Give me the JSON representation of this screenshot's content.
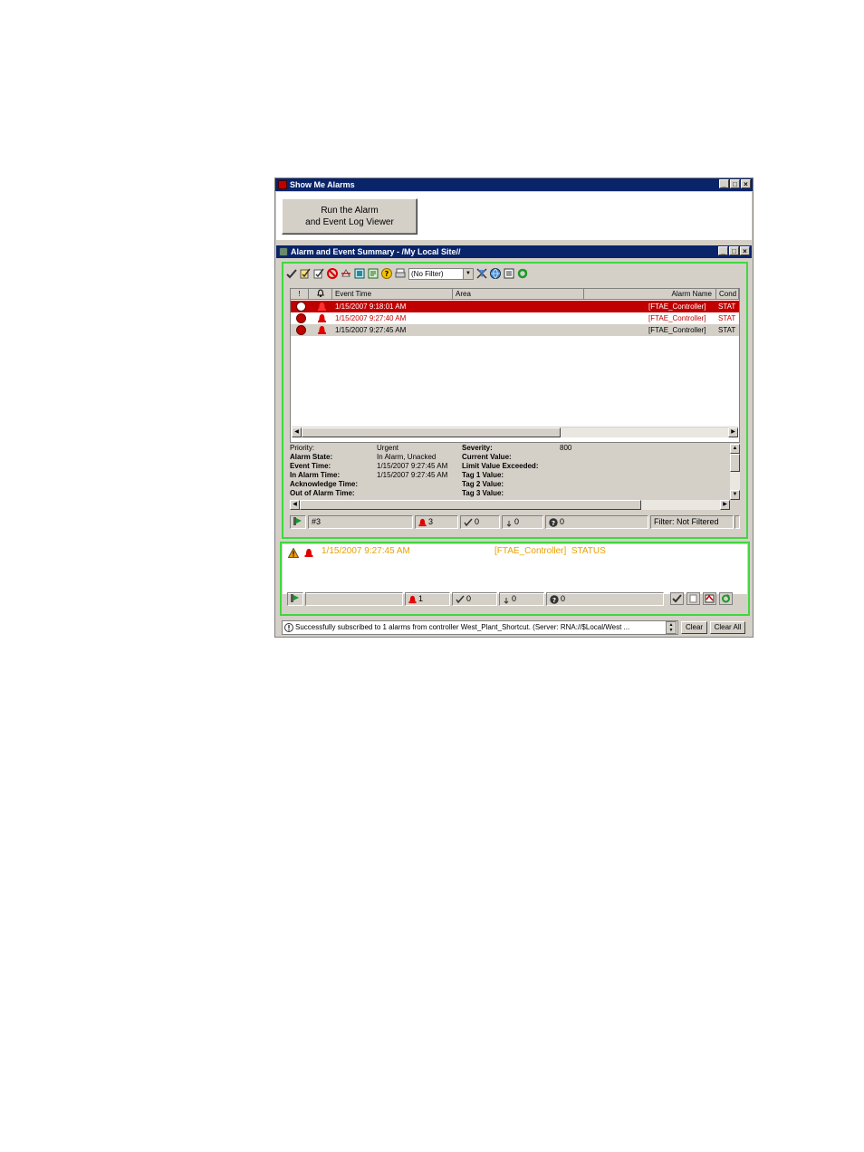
{
  "outer_window": {
    "title": "Show Me Alarms",
    "run_button_label": "Run the Alarm\nand Event Log Viewer"
  },
  "summary_window": {
    "title": "Alarm and Event Summary - /My Local Site//",
    "toolbar": {
      "icons": [
        "acknowledge-icon",
        "acknowledge-page-icon",
        "acknowledge-all-icon",
        "disable-icon",
        "suppress-icon",
        "show-details-icon",
        "properties-icon",
        "help-icon",
        "print-icon",
        "clear-filter-icon",
        "global-icon",
        "list-icon",
        "refresh-icon"
      ],
      "filter_value": "(No Filter)"
    },
    "table": {
      "columns": [
        "!",
        "",
        "Event Time",
        "Area",
        "Alarm Name",
        "Cond"
      ],
      "rows": [
        {
          "event_time": "1/15/2007 9:18:01 AM",
          "alarm_name": "[FTAE_Controller]",
          "cond": "STAT",
          "style": "selected"
        },
        {
          "event_time": "1/15/2007 9:27:40 AM",
          "alarm_name": "[FTAE_Controller]",
          "cond": "STAT",
          "style": "alarm"
        },
        {
          "event_time": "1/15/2007 9:27:45 AM",
          "alarm_name": "[FTAE_Controller]",
          "cond": "STAT",
          "style": "normal"
        }
      ]
    },
    "details": {
      "left": [
        {
          "label": "Priority:",
          "value": "Urgent",
          "bold": false
        },
        {
          "label": "Alarm State:",
          "value": "In Alarm, Unacked",
          "bold": true
        },
        {
          "label": "Event Time:",
          "value": "1/15/2007 9:27:45 AM",
          "bold": true
        },
        {
          "label": "In Alarm Time:",
          "value": "1/15/2007 9:27:45 AM",
          "bold": true
        },
        {
          "label": "Acknowledge Time:",
          "value": "",
          "bold": true
        },
        {
          "label": "Out of Alarm Time:",
          "value": "",
          "bold": true
        }
      ],
      "right": [
        {
          "label": "Severity:",
          "value": "800"
        },
        {
          "label": "Current Value:",
          "value": ""
        },
        {
          "label": "Limit Value Exceeded:",
          "value": ""
        },
        {
          "label": "Tag 1 Value:",
          "value": ""
        },
        {
          "label": "Tag 2 Value:",
          "value": ""
        },
        {
          "label": "Tag 3 Value:",
          "value": ""
        }
      ]
    },
    "status": {
      "total": "#3",
      "in_alarm": "3",
      "acked": "0",
      "suppressed": "0",
      "unknown": "0",
      "filter": "Filter: Not Filtered"
    }
  },
  "banner": {
    "event_time": "1/15/2007 9:27:45 AM",
    "message": "[FTAE_Controller]  STATUS",
    "status": {
      "in_alarm": "1",
      "acked": "0",
      "suppressed": "0",
      "unknown": "0"
    }
  },
  "message_bar": {
    "text": "Successfully subscribed to 1 alarms from controller West_Plant_Shortcut. (Server: RNA://$Local/West ...",
    "clear_label": "Clear",
    "clear_all_label": "Clear All"
  },
  "colors": {
    "selected_row": "#c00000",
    "alarm_text": "#c00000",
    "banner_text": "#e8a000",
    "highlight_border": "#3ed83e",
    "titlebar": "#0a246a"
  }
}
